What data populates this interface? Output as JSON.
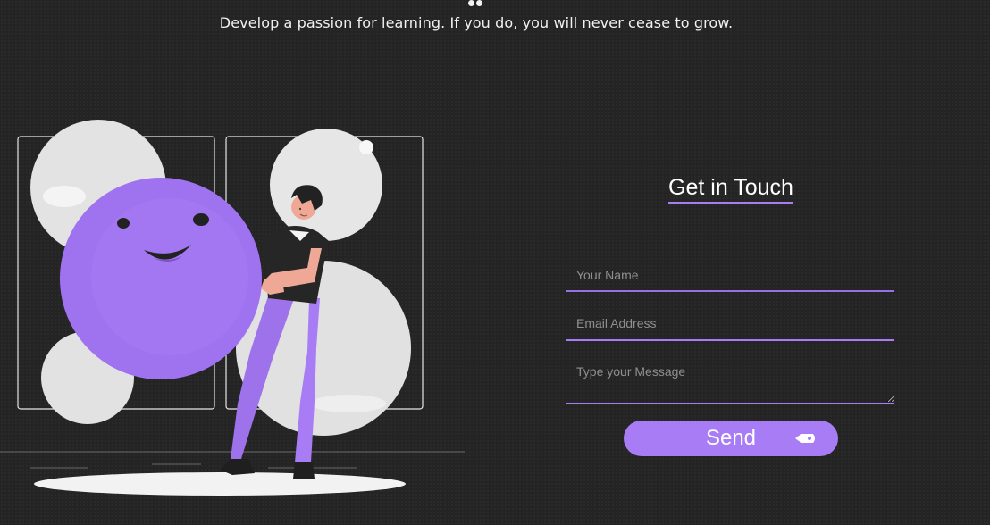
{
  "header": {
    "quote": "Develop a passion for learning. If you do, you will never cease to grow."
  },
  "contact": {
    "title": "Get in Touch",
    "fields": {
      "name_placeholder": "Your Name",
      "email_placeholder": "Email Address",
      "message_placeholder": "Type your Message"
    },
    "send_label": "Send",
    "send_icon": "rocket-icon"
  },
  "illustration": {
    "icon": "person-with-smiling-ball-illustration"
  },
  "colors": {
    "background": "#242424",
    "accent": "#a77cf4",
    "text": "#ffffff",
    "placeholder": "#8f8f8f",
    "illustration_light": "#e5e5e5",
    "illustration_dark": "#2a2a2a"
  }
}
